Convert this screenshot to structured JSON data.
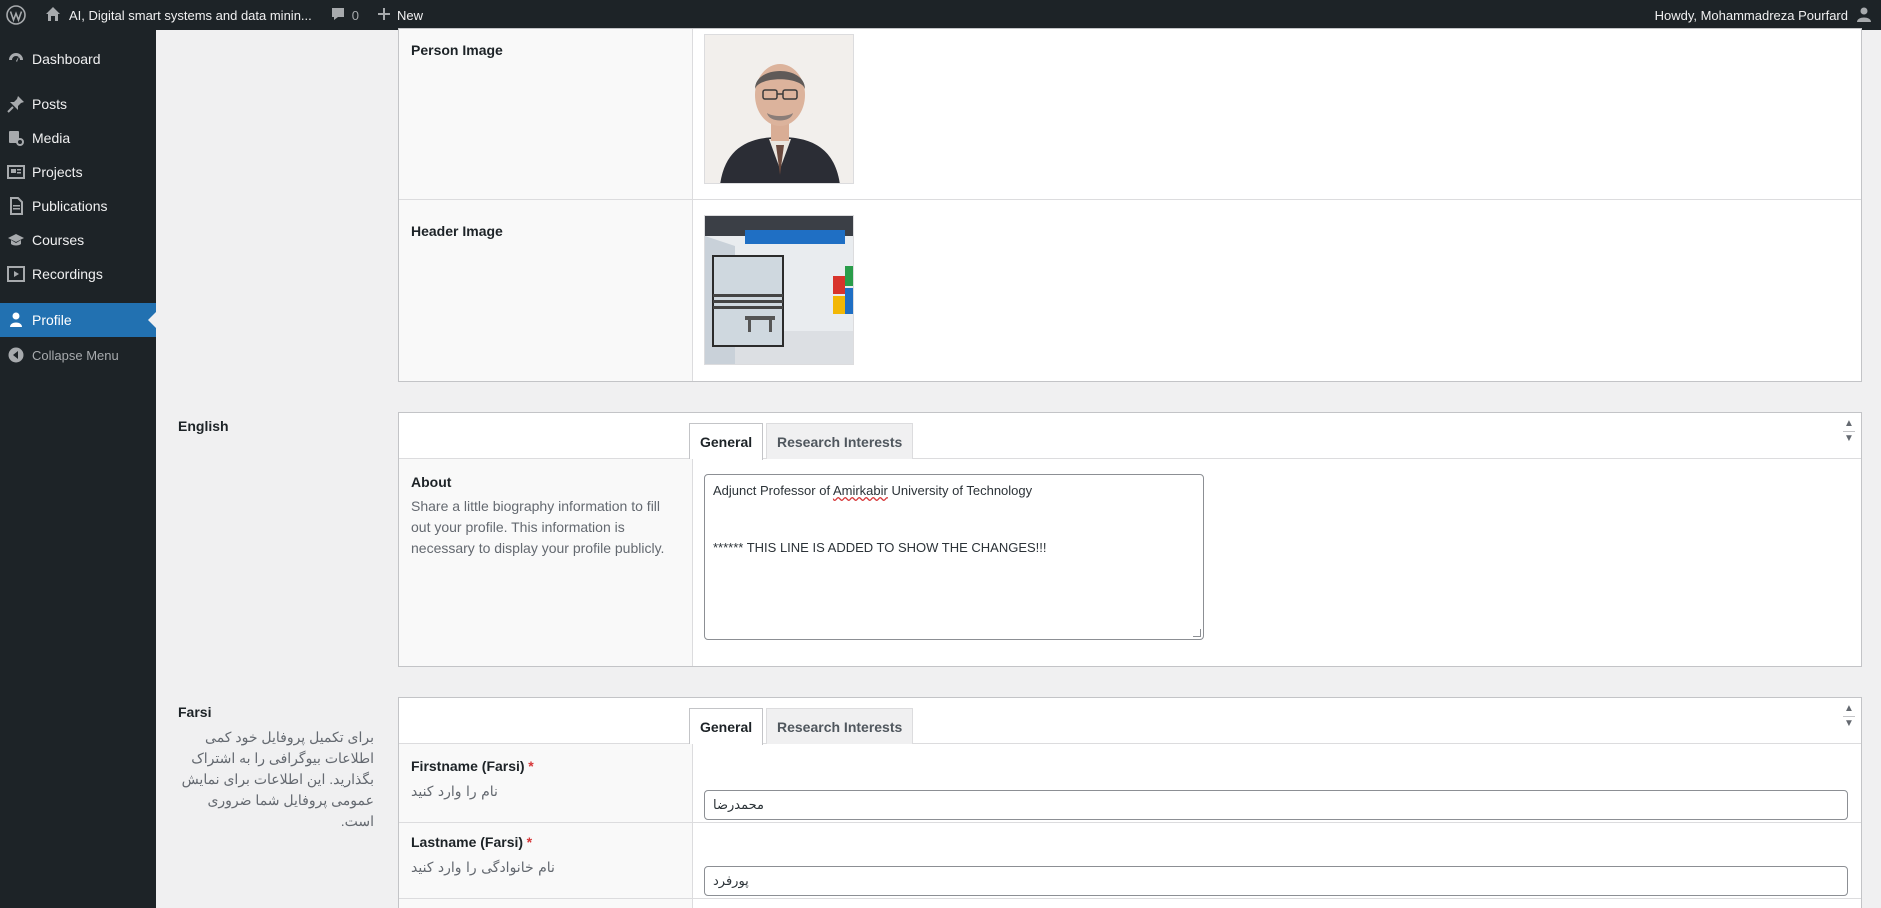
{
  "adminbar": {
    "site_name": "AI, Digital smart systems and data minin...",
    "comments_count": "0",
    "new_label": "New",
    "howdy": "Howdy, Mohammadreza Pourfard"
  },
  "menu": {
    "items": [
      {
        "label": "Dashboard",
        "icon": "dashboard-icon"
      },
      {
        "label": "Posts",
        "icon": "pushpin-icon"
      },
      {
        "label": "Media",
        "icon": "media-icon"
      },
      {
        "label": "Projects",
        "icon": "portfolio-icon"
      },
      {
        "label": "Publications",
        "icon": "document-icon"
      },
      {
        "label": "Courses",
        "icon": "graduation-cap-icon"
      },
      {
        "label": "Recordings",
        "icon": "video-icon"
      },
      {
        "label": "Profile",
        "icon": "user-icon"
      }
    ],
    "current": "Profile",
    "collapse_label": "Collapse Menu"
  },
  "images": {
    "person_image_label": "Person Image",
    "header_image_label": "Header Image"
  },
  "english": {
    "section_title": "English",
    "tabs": [
      "General",
      "Research Interests"
    ],
    "active_tab": "General",
    "about_label": "About",
    "about_desc": "Share a little biography information to fill out your profile. This information is necessary to display your profile publicly.",
    "about_line1_a": "Adjunct Professor of ",
    "about_line1_b": "Amirkabir",
    "about_line1_c": " University of Technology",
    "about_line2": "****** THIS LINE IS ADDED TO SHOW THE CHANGES!!!"
  },
  "farsi": {
    "section_title": "Farsi",
    "section_desc": "برای تکمیل پروفایل خود کمی اطلاعات بیوگرافی را به اشتراک بگذارید. این اطلاعات برای نمایش عمومی پروفایل شما ضروری است.",
    "tabs": [
      "General",
      "Research Interests"
    ],
    "active_tab": "General",
    "firstname_label": "Firstname (Farsi)",
    "firstname_hint": "نام را وارد کنید",
    "firstname_value": "محمدرضا",
    "lastname_label": "Lastname (Farsi)",
    "lastname_hint": "نام خانوادگی را وارد کنید",
    "lastname_value": "پورفرد",
    "required_mark": "*"
  },
  "colors": {
    "adminbar_bg": "#1d2327",
    "menu_current": "#2271b1",
    "required": "#d63638"
  }
}
